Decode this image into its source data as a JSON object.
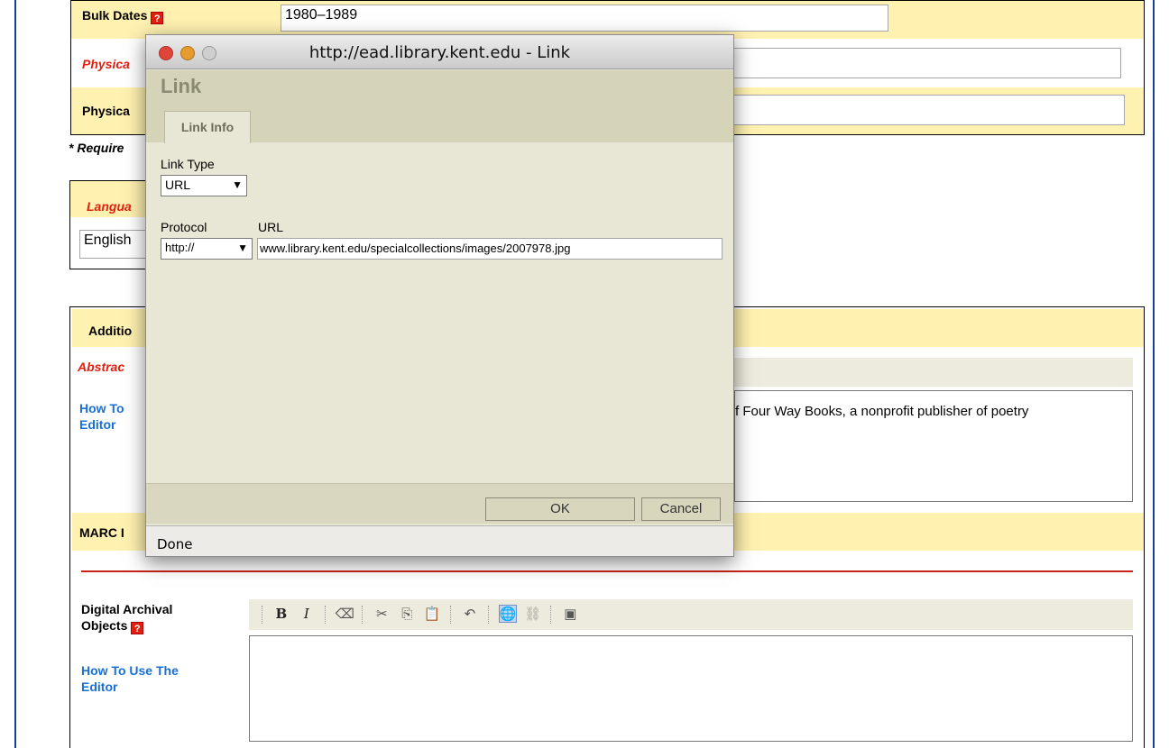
{
  "form": {
    "bulk_dates_label": "Bulk Dates",
    "bulk_dates_value": "1980–1989",
    "physical_label_1": "Physica",
    "physical_label_2": "Physica",
    "required_note": "* Require",
    "language_label": "Langua",
    "language_value": "English",
    "additional_label": "Additio",
    "abstract_label": "Abstrac",
    "how_to_label": "How To",
    "editor_label": "Editor",
    "abstract_text": "f Four Way Books, a nonprofit publisher of poetry",
    "marc_label": "MARC I",
    "digital_label_line1": "Digital Archival",
    "digital_label_line2": "Objects",
    "how_to_use_line1": "How To Use The",
    "how_to_use_line2": "Editor",
    "help_glyph": "?"
  },
  "toolbar": {
    "bold": "B",
    "italic": "I"
  },
  "dialog": {
    "title": "http://ead.library.kent.edu - Link",
    "heading": "Link",
    "tab_label": "Link Info",
    "link_type_label": "Link Type",
    "link_type_value": "URL",
    "protocol_label": "Protocol",
    "protocol_value": "http://",
    "url_label": "URL",
    "url_value": "www.library.kent.edu/specialcollections/images/2007978.jpg",
    "ok_label": "OK",
    "cancel_label": "Cancel",
    "status_text": "Done"
  },
  "colors": {
    "close": "#e0453b",
    "minimize": "#e79b2f",
    "zoom": "#cfcfcf",
    "required_red": "#e2200f",
    "link_blue": "#1a6fd6",
    "section_yellow": "#fff1b0"
  }
}
